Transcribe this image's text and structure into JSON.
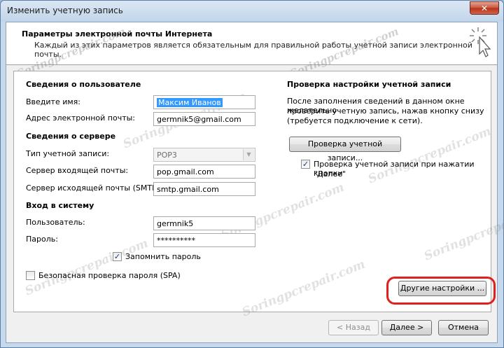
{
  "window": {
    "title": "Изменить учетную запись",
    "close_label": "✕"
  },
  "header": {
    "title": "Параметры электронной почты Интернета",
    "subtitle": "Каждый из этих параметров является обязательным для правильной работы учетной записи электронной почты."
  },
  "user_info": {
    "section_title": "Сведения о пользователе",
    "name_label": "Введите имя:",
    "name_value": "Максим Иванов",
    "email_label": "Адрес электронной почты:",
    "email_value": "germnik5@gmail.com"
  },
  "server_info": {
    "section_title": "Сведения о сервере",
    "account_type_label": "Тип учетной записи:",
    "account_type_value": "POP3",
    "incoming_label": "Сервер входящей почты:",
    "incoming_value": "pop.gmail.com",
    "outgoing_label": "Сервер исходящей почты (SMTP):",
    "outgoing_value": "smtp.gmail.com"
  },
  "logon": {
    "section_title": "Вход в систему",
    "user_label": "Пользователь:",
    "user_value": "germnik5",
    "password_label": "Пароль:",
    "password_value": "**********",
    "remember_label": "Запомнить пароль",
    "spa_label": "Безопасная проверка пароля (SPA)"
  },
  "test": {
    "section_title": "Проверка настройки учетной записи",
    "description_1": "После заполнения сведений в данном окне желательно",
    "description_2": "проверить учетную запись, нажав кнопку снизу",
    "description_3": "(требуется подключение к сети).",
    "test_button": "Проверка учетной записи...",
    "auto_test_label_1": "Проверка учетной записи при нажатии кнопки",
    "auto_test_label_2": "\"Далее\""
  },
  "buttons": {
    "more_settings": "Другие настройки ...",
    "back": "< Назад",
    "next": "Далее >",
    "cancel": "Отмена"
  },
  "watermark": {
    "text": "Soringpcrepair.com"
  },
  "colors": {
    "highlight_ring": "#e0201c",
    "selection": "#3399ff"
  }
}
